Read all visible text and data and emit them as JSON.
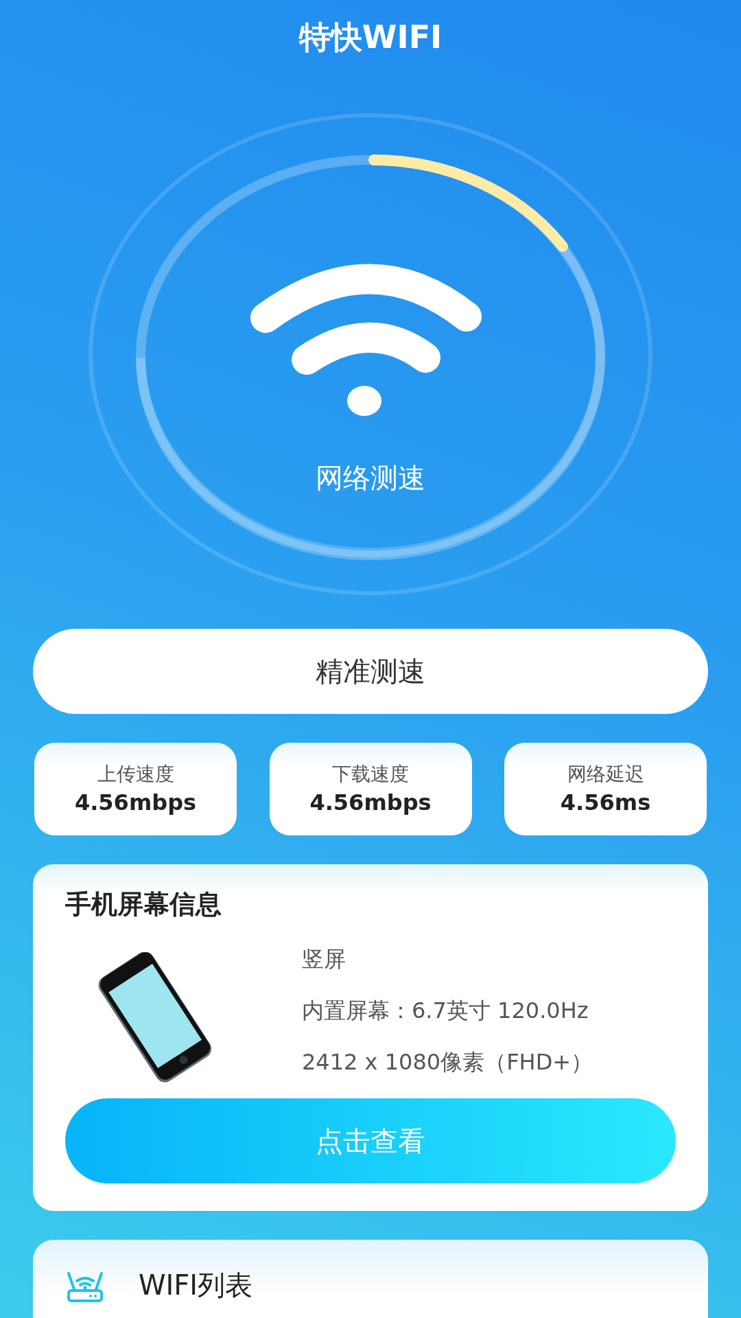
{
  "app_title": "特快WIFI",
  "gauge": {
    "label": "网络测速"
  },
  "precise_test_button": "精准测速",
  "stats": [
    {
      "label": "上传速度",
      "value": "4.56mbps"
    },
    {
      "label": "下载速度",
      "value": "4.56mbps"
    },
    {
      "label": "网络延迟",
      "value": "4.56ms"
    }
  ],
  "screen_info": {
    "title": "手机屏幕信息",
    "lines": [
      "竖屏",
      "内置屏幕：6.7英寸 120.0Hz",
      "2412 x 1080像素（FHD+）"
    ],
    "button": "点击查看"
  },
  "wifi_list": {
    "title": "WIFI列表"
  }
}
